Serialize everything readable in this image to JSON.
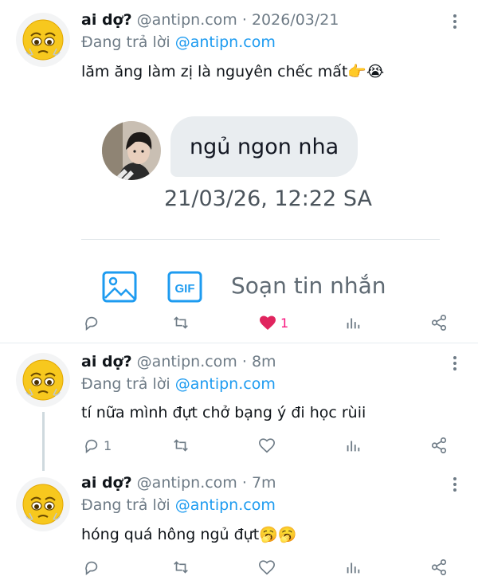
{
  "tweets": [
    {
      "name": "ai dợ?",
      "handle": "@antipn.com",
      "separator": "·",
      "time": "2026/03/21",
      "replying_prefix": "Đang trả lời",
      "replying_to": "@antipn.com",
      "text": "lăm ăng làm zị là nguyên chếc mất👉😭",
      "embed": {
        "bubble_text": "ngủ ngon nha",
        "timestamp": "21/03/26, 12:22 SA",
        "composer_placeholder": "Soạn tin nhắn",
        "gif_label": "GIF"
      },
      "actions": {
        "reply_count": "",
        "retweet_count": "",
        "like_count": "1",
        "liked": true
      }
    },
    {
      "name": "ai dợ?",
      "handle": "@antipn.com",
      "separator": "·",
      "time": "8m",
      "replying_prefix": "Đang trả lời",
      "replying_to": "@antipn.com",
      "text": "tí nữa mình đựt chở bạng ý đi học rùii",
      "actions": {
        "reply_count": "1",
        "retweet_count": "",
        "like_count": "",
        "liked": false
      }
    },
    {
      "name": "ai dợ?",
      "handle": "@antipn.com",
      "separator": "·",
      "time": "7m",
      "replying_prefix": "Đang trả lời",
      "replying_to": "@antipn.com",
      "text": "hóng quá hông ngủ đựt🥱🥱",
      "actions": {
        "reply_count": "",
        "retweet_count": "",
        "like_count": "",
        "liked": false
      }
    }
  ],
  "colors": {
    "link": "#1d9bf0",
    "muted": "#6e7b86",
    "like": "#f91880",
    "icon_accent": "#1d9bf0"
  },
  "icons": [
    "pleading-face-avatar",
    "more-vertical-icon",
    "reply-icon",
    "retweet-icon",
    "heart-icon",
    "analytics-icon",
    "share-icon",
    "image-icon",
    "gif-icon"
  ]
}
